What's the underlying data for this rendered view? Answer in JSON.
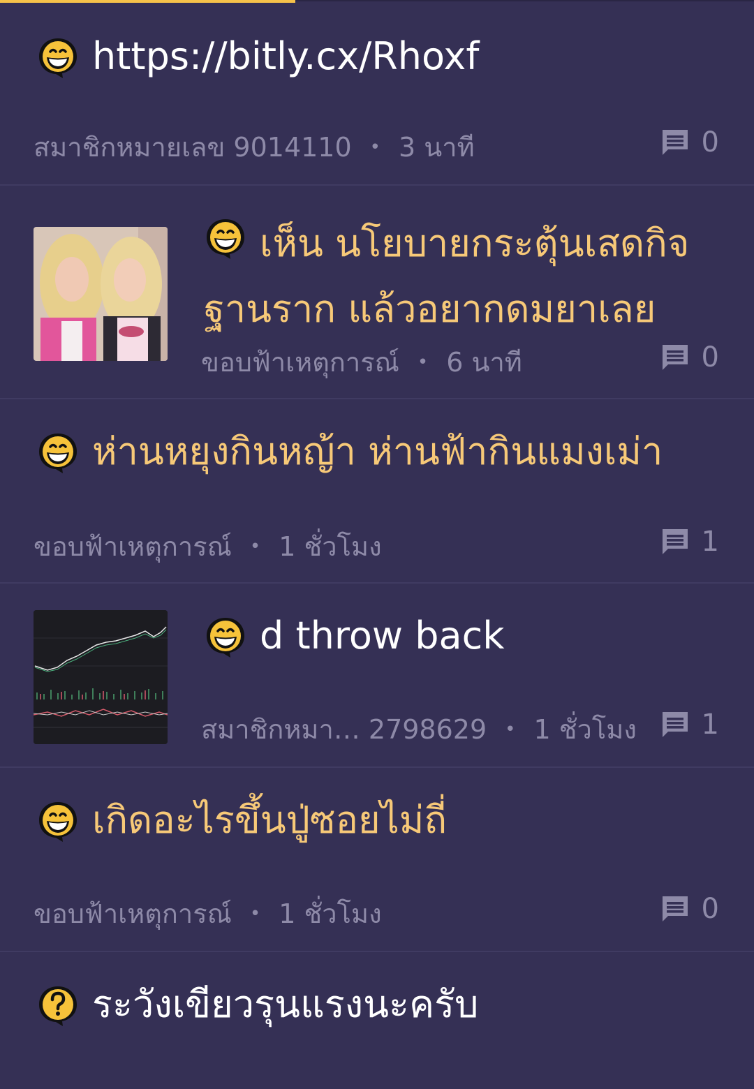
{
  "topics": [
    {
      "title": "https://bitly.cx/Rhoxf",
      "author": "สมาชิกหมายเลข 9014110",
      "time": "3 นาที",
      "comments": "0",
      "icon": "grin-face-icon"
    },
    {
      "title": "เห็น นโยบายกระตุ้นเสดกิจฐานราก แล้วอยากดมยาเลย",
      "author": "ขอบฟ้าเหตุการณ์",
      "time": "6 นาที",
      "comments": "0",
      "icon": "grin-face-icon",
      "thumbnail": "two-blonde-women-photo"
    },
    {
      "title": "ห่านหยุงกินหญ้า ห่านฟ้ากินแมงเม่า",
      "author": "ขอบฟ้าเหตุการณ์",
      "time": "1 ชั่วโมง",
      "comments": "1",
      "icon": "grin-face-icon"
    },
    {
      "title": "d throw back",
      "author": "สมาชิกหมา… 2798629",
      "time": "1 ชั่วโมง",
      "comments": "1",
      "icon": "grin-face-icon",
      "thumbnail": "stock-chart-screenshot"
    },
    {
      "title": "เกิดอะไรขึ้นปู่ซอยไม่ถี่",
      "author": "ขอบฟ้าเหตุการณ์",
      "time": "1 ชั่วโมง",
      "comments": "0",
      "icon": "grin-face-icon"
    },
    {
      "title": "ระวังเขียวรุนแรงนะครับ",
      "author": "",
      "time": "",
      "comments": "",
      "icon": "question-bubble-icon"
    }
  ],
  "colors": {
    "background": "#353055",
    "gold_title": "#f7c978",
    "meta_text": "#8e8aa8",
    "accent": "#f6c24a"
  }
}
